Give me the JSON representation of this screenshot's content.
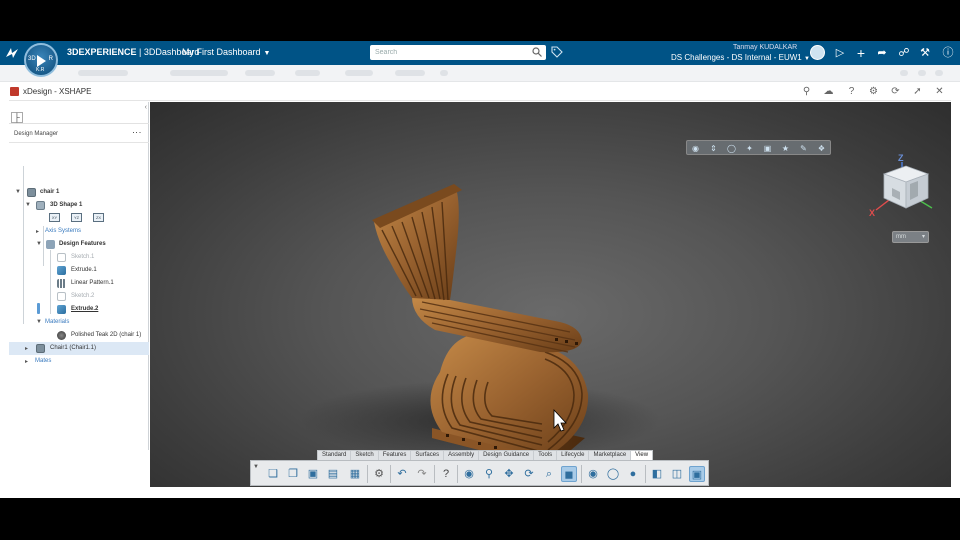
{
  "topbar": {
    "brand_prefix": "3DEXPERIENCE",
    "brand_app": "3DDashboard",
    "dashboard": "My First Dashboard",
    "search_placeholder": "Search",
    "user": "Tanmay KUDALKAR",
    "space": "DS Challenges - DS Internal - EUW1",
    "compass_user": "K.R"
  },
  "app": {
    "title": "xDesign - XSHAPE"
  },
  "design_manager": {
    "title": "Design Manager",
    "tree": [
      {
        "label": "chair 1",
        "level": 0
      },
      {
        "label": "3D Shape 1",
        "level": 1
      },
      {
        "label": "Axis Systems",
        "level": 2
      },
      {
        "label": "Design Features",
        "level": 2
      },
      {
        "label": "Sketch.1",
        "level": 3
      },
      {
        "label": "Extrude.1",
        "level": 3
      },
      {
        "label": "Linear Pattern.1",
        "level": 3
      },
      {
        "label": "Sketch.2",
        "level": 3
      },
      {
        "label": "Extrude.2",
        "level": 3
      },
      {
        "label": "Materials",
        "level": 2
      },
      {
        "label": "Polished Teak 2D (chair 1)",
        "level": 3
      },
      {
        "label": "Chair1 (Chair1.1)",
        "level": 1
      },
      {
        "label": "Mates",
        "level": 1
      }
    ],
    "planes": [
      "XY",
      "YZ",
      "ZX"
    ]
  },
  "viewport": {
    "unit": "mm",
    "axis": {
      "x": "X",
      "z": "Z"
    }
  },
  "tabs": [
    "Standard",
    "Sketch",
    "Features",
    "Surfaces",
    "Assembly",
    "Design Guidance",
    "Tools",
    "Lifecycle",
    "Marketplace",
    "View"
  ],
  "active_tab": "View",
  "colors": {
    "topbar": "#005386",
    "accent": "#3a7bbf",
    "wood_light": "#b07a3e",
    "wood_dark": "#5a3414"
  }
}
